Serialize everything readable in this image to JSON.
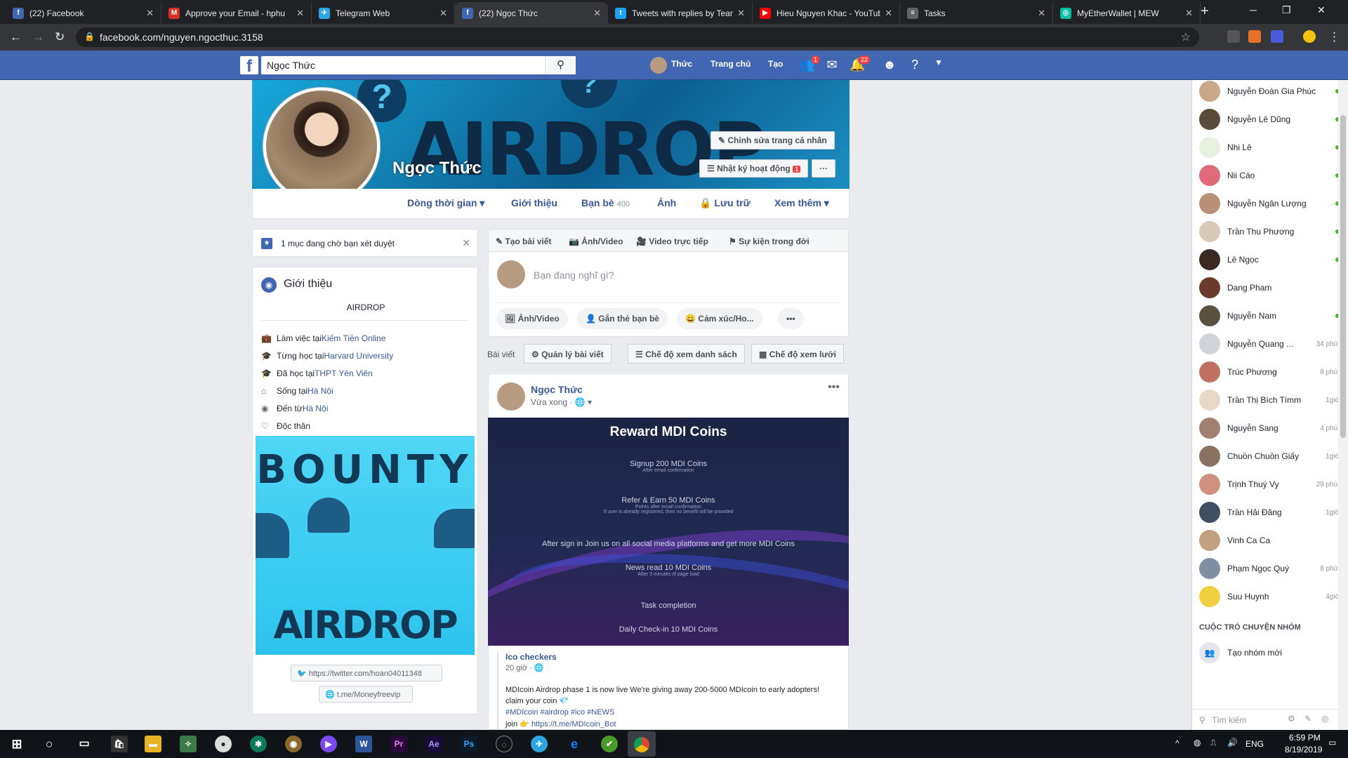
{
  "tabs": [
    {
      "title": "(22) Facebook",
      "color": "#4267b2",
      "icon": "f"
    },
    {
      "title": "Approve your Email - hphu",
      "color": "#d93025",
      "icon": "M"
    },
    {
      "title": "Telegram Web",
      "color": "#2ca5e0",
      "icon": "✈"
    },
    {
      "title": "(22) Ngọc Thức",
      "color": "#4267b2",
      "icon": "f"
    },
    {
      "title": "Tweets with replies by Team",
      "color": "#1da1f2",
      "icon": "t"
    },
    {
      "title": "Hieu Nguyen Khac - YouTub",
      "color": "#ff0000",
      "icon": "▶"
    },
    {
      "title": "Tasks",
      "color": "#5f6368",
      "icon": "≡"
    },
    {
      "title": "MyEtherWallet | MEW",
      "color": "#05c0a5",
      "icon": "◎"
    }
  ],
  "address": {
    "url": "facebook.com/nguyen.ngocthuc.3158"
  },
  "fbbar": {
    "search_value": "Ngọc Thức",
    "profile_name": "Thức",
    "home": "Trang chủ",
    "create": "Tạo",
    "friend_badge": "1",
    "notif_badge": "22"
  },
  "profile": {
    "name": "Ngọc Thức",
    "cover_text": "AIRDROP",
    "edit_profile": "Chỉnh sửa trang cá nhân",
    "activity_log": "Nhật ký hoạt động",
    "activity_badge": "1",
    "more": "···",
    "tabs": {
      "timeline": "Dòng thời gian",
      "about": "Giới thiệu",
      "friends": "Bạn bè",
      "friends_count": "400",
      "photos": "Ảnh",
      "archive": "Lưu trữ",
      "more": "Xem thêm"
    }
  },
  "pending": "1 mục đang chờ bạn xét duyệt",
  "intro": {
    "title": "Giới thiệu",
    "bio": "AIRDROP",
    "rows": [
      {
        "icon": "briefcase-icon",
        "glyph": "💼",
        "prefix": "Làm việc tại ",
        "link": "Kiếm Tiền Online"
      },
      {
        "icon": "school-icon",
        "glyph": "🎓",
        "prefix": "Từng học tại ",
        "link": "Harvard University"
      },
      {
        "icon": "school-icon",
        "glyph": "🎓",
        "prefix": "Đã học tại ",
        "link": "THPT Yên Viên"
      },
      {
        "icon": "home-icon",
        "glyph": "⌂",
        "prefix": "Sống tại ",
        "link": "Hà Nội"
      },
      {
        "icon": "pin-icon",
        "glyph": "◉",
        "prefix": "Đến từ ",
        "link": "Hà Nội"
      },
      {
        "icon": "heart-icon",
        "glyph": "♡",
        "prefix": "Độc thân",
        "link": ""
      }
    ],
    "bounty_title": "BOUNTY",
    "bounty_sub": "AIRDROP",
    "links": [
      "https://twitter.com/hoan04011348",
      "t.me/Moneyfreevip"
    ]
  },
  "composer": {
    "tabs": [
      "Tạo bài viết",
      "Ảnh/Video",
      "Video trực tiếp",
      "Sự kiện trong đời"
    ],
    "placeholder": "Bạn đang nghĩ gì?",
    "pills": [
      "Ảnh/Video",
      "Gắn thẻ bạn bè",
      "Cảm xúc/Ho...",
      "•••"
    ]
  },
  "postbar": {
    "label": "Bài viết",
    "manage": "Quản lý bài viết",
    "list": "Chế độ xem danh sách",
    "grid": "Chế độ xem lưới"
  },
  "post": {
    "author": "Ngọc Thức",
    "time": "Vừa xong",
    "image": {
      "title": "Reward MDI Coins",
      "lines": [
        {
          "t": "Signup 200 MDI Coins",
          "s": "After email confirmation"
        },
        {
          "t": "Refer & Earn 50 MDI Coins",
          "s": "Points after email confirmation\nIf user is already registered, then no benefit will be provided"
        },
        {
          "t": "After sign in Join us on all social media platforms and get more MDI Coins",
          "s": ""
        },
        {
          "t": "News read 10 MDI Coins",
          "s": "After 3 minutes of page load"
        },
        {
          "t": "Task completion",
          "s": ""
        },
        {
          "t": "Daily Check-in 10 MDI Coins",
          "s": ""
        }
      ]
    },
    "shared": {
      "source": "Ico checkers",
      "time": "20 giờ",
      "text": "MDIcoin Airdrop phase 1 is now live We're giving away 200-5000 MDIcoin to early adopters! claim your coin 💎",
      "tags": "#MDIcoin #airdrop #ico #NEWS",
      "join_prefix": "join 👉 ",
      "join_link": "https://t.me/MDIcoin_Bot"
    }
  },
  "chat": {
    "friends": [
      {
        "name": "Nguyễn Đoàn Gia Phúc",
        "status": "online",
        "color": "#c9a88a"
      },
      {
        "name": "Nguyễn Lê Dũng",
        "status": "online",
        "color": "#5a4a3a"
      },
      {
        "name": "Nhi Lê",
        "status": "online",
        "color": "#e8f0e0"
      },
      {
        "name": "Nii Cáo",
        "status": "online",
        "color": "#e06a7a"
      },
      {
        "name": "Nguyễn Ngân Lượng",
        "status": "online",
        "color": "#b89078"
      },
      {
        "name": "Trần Thu Phương",
        "status": "online",
        "color": "#d8c8b8"
      },
      {
        "name": "Lê Ngọc",
        "status": "online",
        "color": "#3a2a22"
      },
      {
        "name": "Dang Pham",
        "status": "",
        "color": "#6a3a2a"
      },
      {
        "name": "Nguyễn Nam",
        "status": "online",
        "color": "#5a5040"
      },
      {
        "name": "Nguyễn Quang ...",
        "status": "34 phút",
        "color": "#d0d4da"
      },
      {
        "name": "Trúc Phương",
        "status": "8 phút",
        "color": "#c07060"
      },
      {
        "name": "Trần Thị Bích Tímm",
        "status": "1giờ",
        "color": "#e8d8c8"
      },
      {
        "name": "Nguyễn Sang",
        "status": "4 phút",
        "color": "#a08070"
      },
      {
        "name": "Chuồn Chuồn Giấy",
        "status": "1giờ",
        "color": "#8a7060"
      },
      {
        "name": "Trịnh Thuý Vy",
        "status": "29 phút",
        "color": "#d09080"
      },
      {
        "name": "Trần Hải Đăng",
        "status": "1giờ",
        "color": "#405060"
      },
      {
        "name": "Vinh Ca Ca",
        "status": "",
        "color": "#c0a080"
      },
      {
        "name": "Phạm Ngọc Quý",
        "status": "8 phút",
        "color": "#8090a0"
      },
      {
        "name": "Suu Huynh",
        "status": "4giờ",
        "color": "#f0d040"
      }
    ],
    "group_header": "CUỘC TRÒ CHUYỆN NHÓM",
    "new_group": "Tạo nhóm mới",
    "search_placeholder": "Tìm kiếm"
  },
  "taskbar": {
    "lang": "ENG",
    "time": "6:59 PM",
    "date": "8/19/2019"
  }
}
